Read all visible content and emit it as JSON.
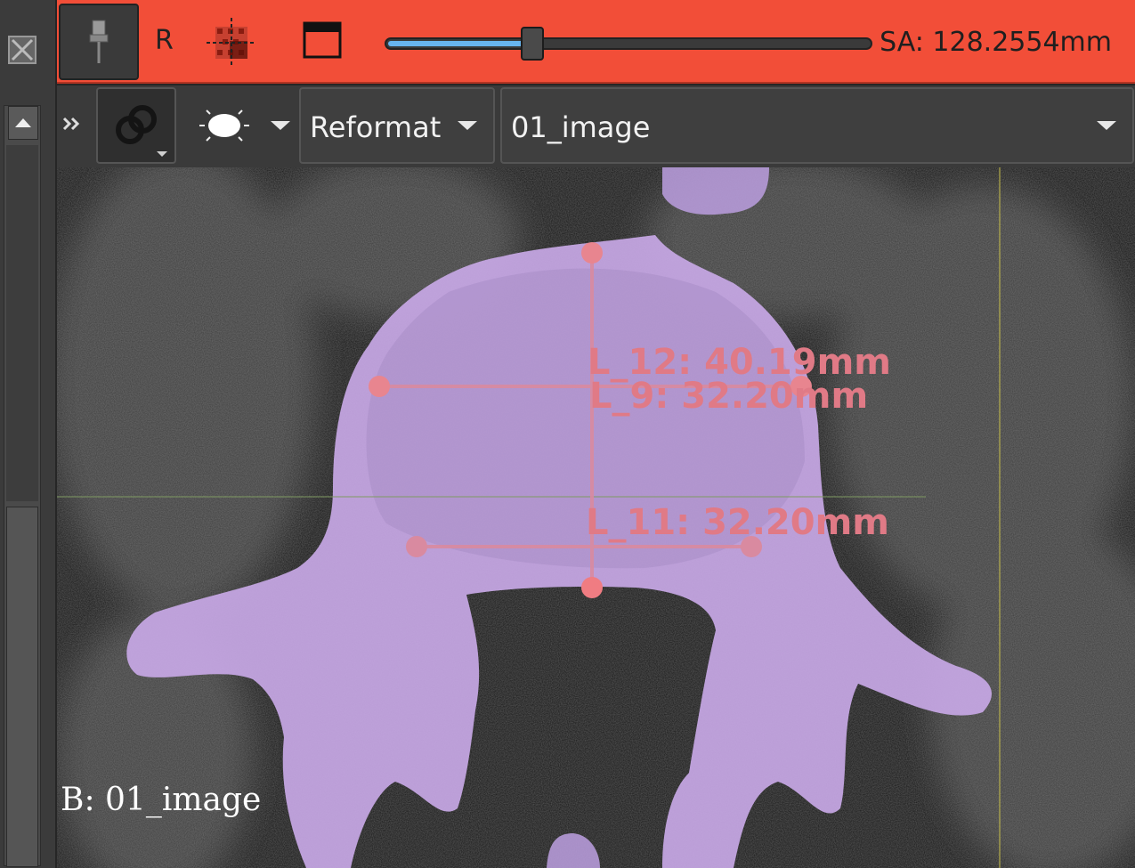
{
  "slice_bar": {
    "orientation_label": "R",
    "slice_offset": "SA: 128.2554mm",
    "slider_position": 0.3,
    "color": "#f24e38"
  },
  "controller_bar": {
    "reformat_label": "Reformat",
    "volume_label": "01_image"
  },
  "viewport": {
    "view_label": "B: 01_image",
    "segmentation_color": "#c8a8e6",
    "measurement_color": "#e07a86",
    "measurements": [
      {
        "name": "L_12",
        "text": "L_12: 40.19mm"
      },
      {
        "name": "L_9",
        "text": "L_9: 32.20mm"
      },
      {
        "name": "L_11",
        "text": "L_11: 32.20mm"
      }
    ]
  },
  "icons": [
    "close-view-icon",
    "scroll-up-icon",
    "pin-icon",
    "crosshair-icon",
    "layout-icon",
    "expand-icon",
    "link-icon",
    "visibility-icon",
    "chevron-down-icon"
  ]
}
